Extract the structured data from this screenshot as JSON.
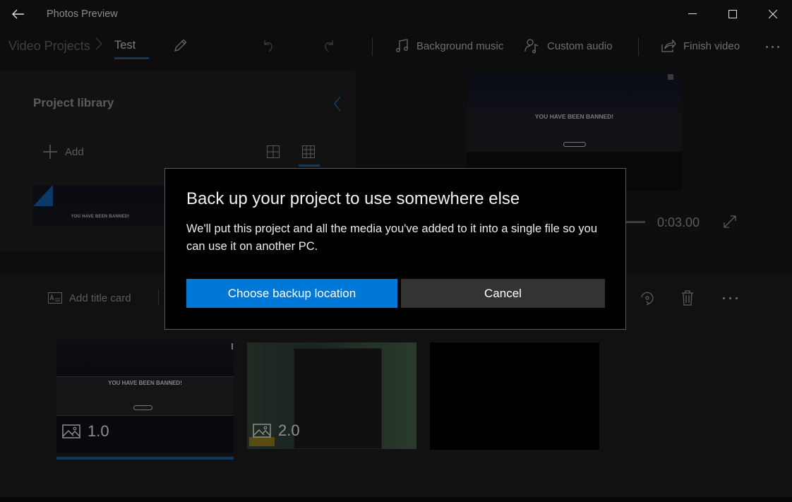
{
  "window": {
    "title": "Photos Preview",
    "controls": {
      "minimize": "minimize-icon",
      "maximize": "maximize-icon",
      "close": "close-icon"
    }
  },
  "commandbar": {
    "breadcrumb": {
      "root": "Video Projects",
      "separator": "›",
      "current": "Test"
    },
    "actions": {
      "background_music": "Background music",
      "custom_audio": "Custom audio",
      "finish_video": "Finish video"
    },
    "icons": [
      "back-arrow-icon",
      "pencil-icon",
      "undo-icon",
      "redo-icon",
      "music-note-icon",
      "person-audio-icon",
      "share-icon",
      "more-icon"
    ]
  },
  "library": {
    "title": "Project library",
    "add_label": "Add",
    "thumbnail_text": "YOU HAVE BEEN BANNED!"
  },
  "preview": {
    "banner": "YOU HAVE BEEN BANNED!",
    "time": "0:03.00"
  },
  "storyboard": {
    "add_title_card": "Add title card",
    "cards": [
      {
        "duration": "1.0",
        "banner": "YOU HAVE BEEN BANNED!",
        "selected": true
      },
      {
        "duration": "2.0",
        "selected": false
      },
      {
        "duration": "",
        "selected": false
      }
    ]
  },
  "dialog": {
    "title": "Back up your project to use somewhere else",
    "body": "We'll put this project and all the media you've added to it into a single file so you can use it on another PC.",
    "primary_label": "Choose backup location",
    "cancel_label": "Cancel"
  },
  "colors": {
    "accent": "#0078d7",
    "accent_dim": "#0b3a66",
    "background": "#0d0d0d",
    "dialog_bg": "#000000",
    "secondary_button": "#333333"
  }
}
